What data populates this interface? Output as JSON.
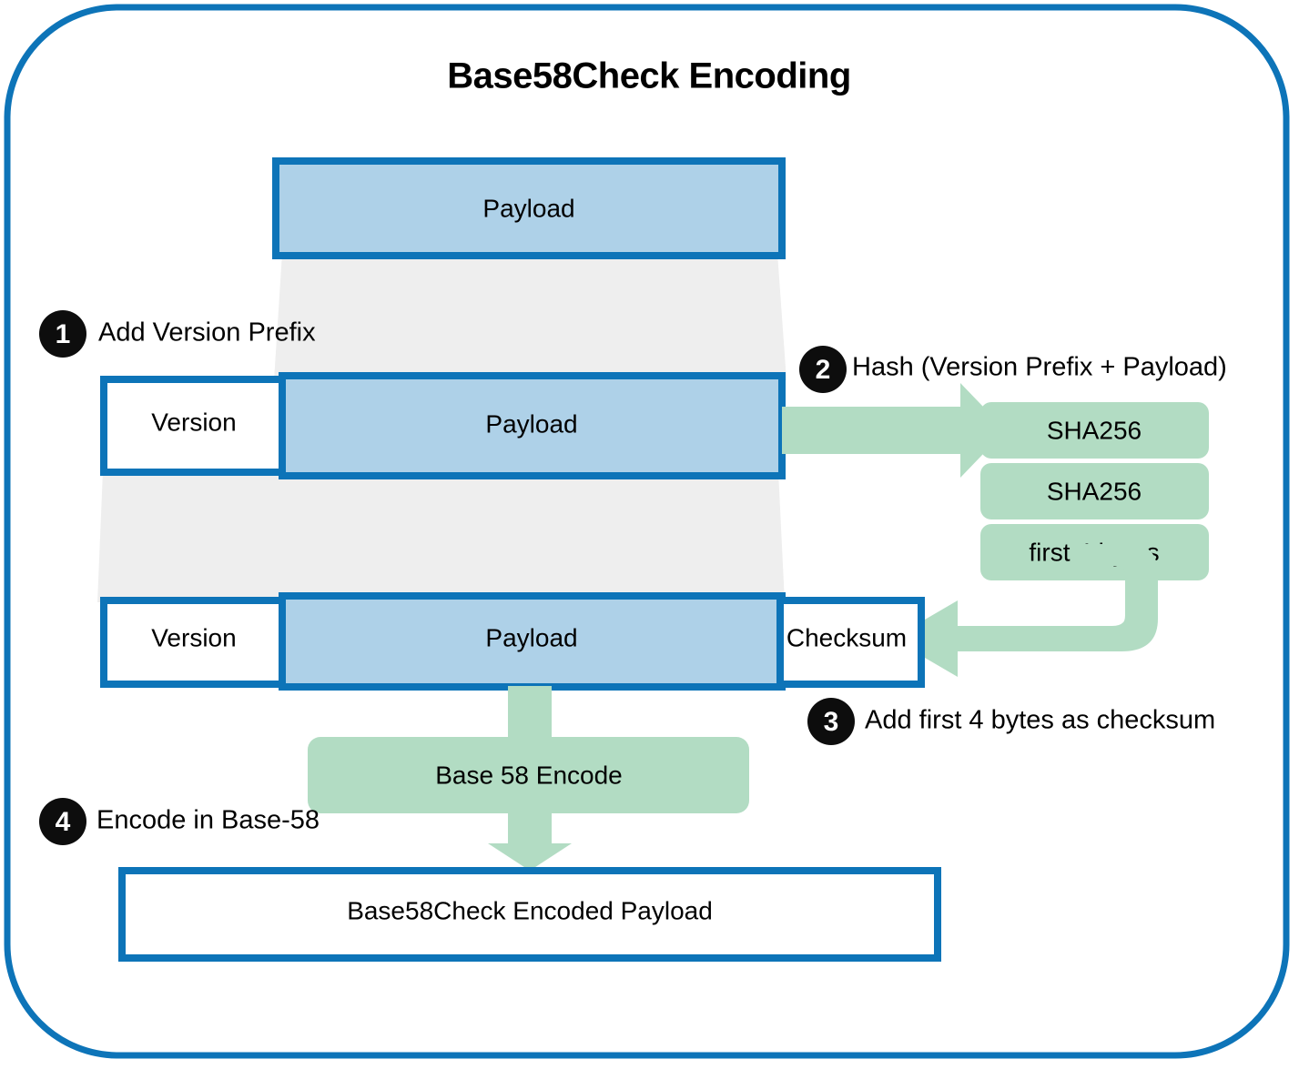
{
  "diagram": {
    "title": "Base58Check Encoding",
    "colors": {
      "border_blue": "#0d74b8",
      "payload_fill": "#aed1e8",
      "connector_gray": "#eeeeee",
      "green": "#b2dcc3",
      "badge_black": "#0d0d0d",
      "white": "#ffffff"
    },
    "rows": {
      "row1": {
        "payload": "Payload"
      },
      "row2": {
        "version": "Version",
        "payload": "Payload"
      },
      "row3": {
        "version": "Version",
        "payload": "Payload",
        "checksum": "Checksum"
      }
    },
    "hash_boxes": [
      {
        "label": "SHA256"
      },
      {
        "label": "SHA256"
      },
      {
        "label": "first 4 bytes"
      }
    ],
    "encode_box": {
      "label": "Base 58 Encode"
    },
    "output_box": {
      "label": "Base58Check Encoded Payload"
    },
    "steps": [
      {
        "number": "1",
        "label": "Add Version Prefix"
      },
      {
        "number": "2",
        "label": "Hash (Version Prefix + Payload)"
      },
      {
        "number": "3",
        "label": "Add first 4 bytes as checksum"
      },
      {
        "number": "4",
        "label": "Encode in Base-58"
      }
    ]
  }
}
